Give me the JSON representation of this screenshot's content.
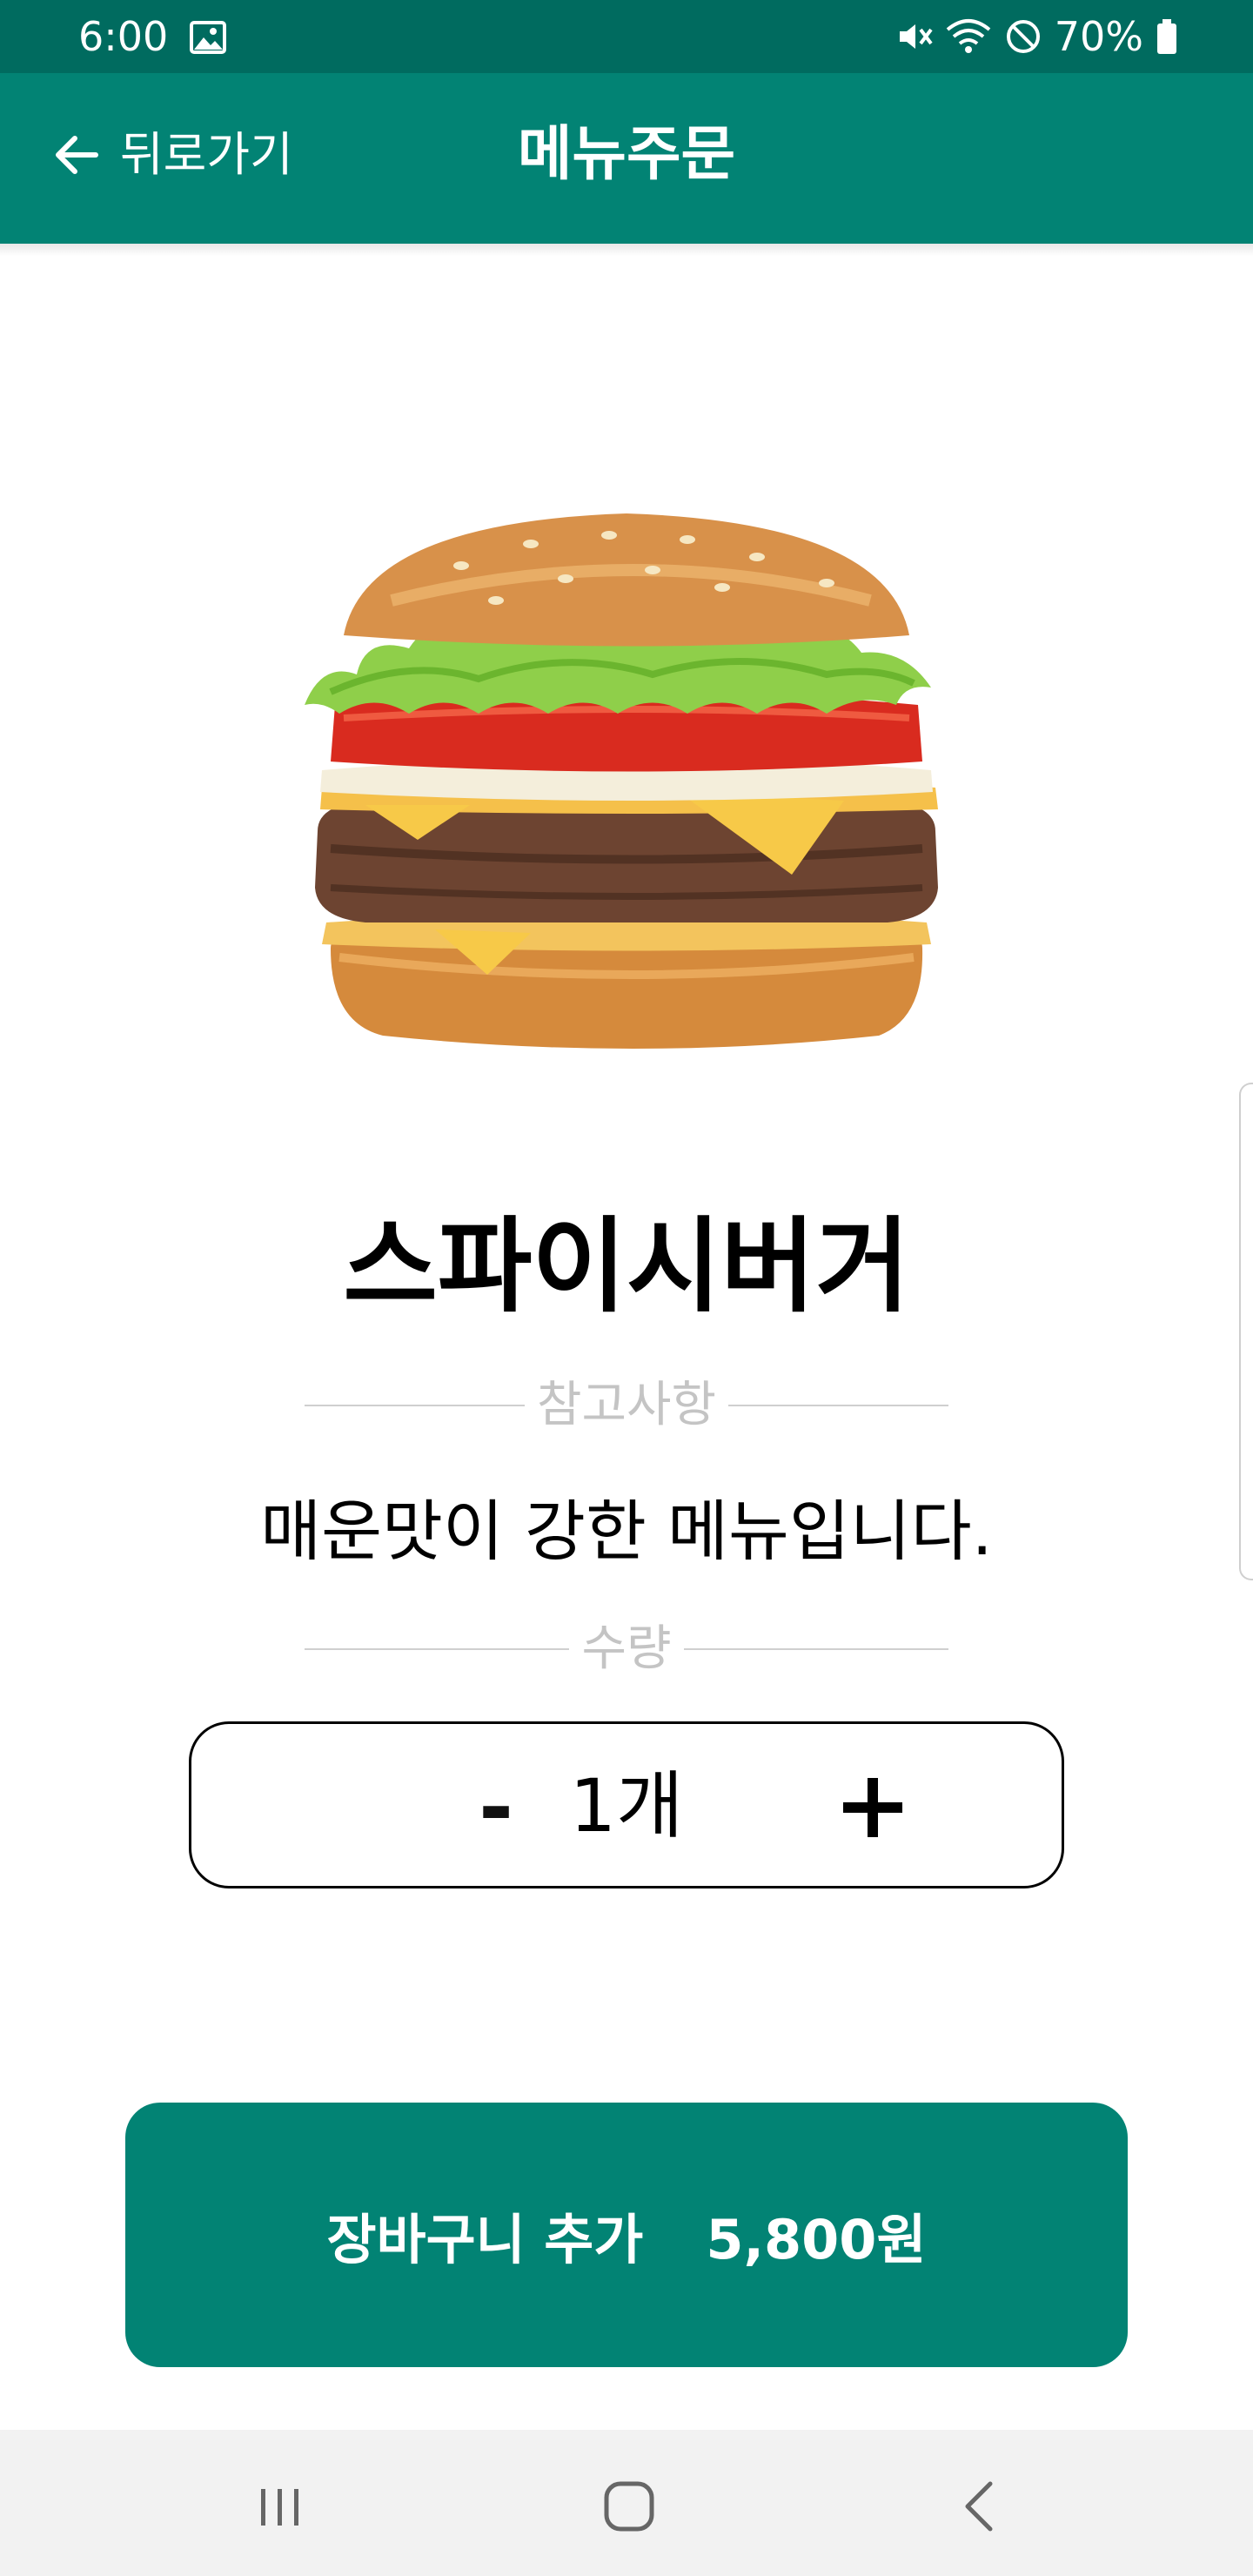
{
  "status_bar": {
    "time": "6:00",
    "battery": "70%",
    "icons": [
      "gallery-icon",
      "mute-icon",
      "wifi-icon",
      "do-not-disturb-icon",
      "battery-icon"
    ]
  },
  "app_bar": {
    "back_label": "뒤로가기",
    "title": "메뉴주문",
    "back_icon": "arrow-left-icon"
  },
  "product": {
    "image": "burger-icon",
    "name": "스파이시버거",
    "notes_label": "참고사항",
    "description": "매운맛이 강한 메뉴입니다.",
    "quantity_label": "수량"
  },
  "quantity": {
    "minus_label": "-",
    "value": "1개",
    "plus_icon": "plus-icon"
  },
  "cart_button": {
    "label": "장바구니 추가",
    "price": "5,800원"
  },
  "nav_bar": {
    "icons": [
      "recents-icon",
      "home-icon",
      "back-icon"
    ]
  },
  "colors": {
    "status_bar": "#006b5f",
    "app_bar": "#028374",
    "cart_button": "#028374",
    "divider_text": "#c4c4c4"
  }
}
